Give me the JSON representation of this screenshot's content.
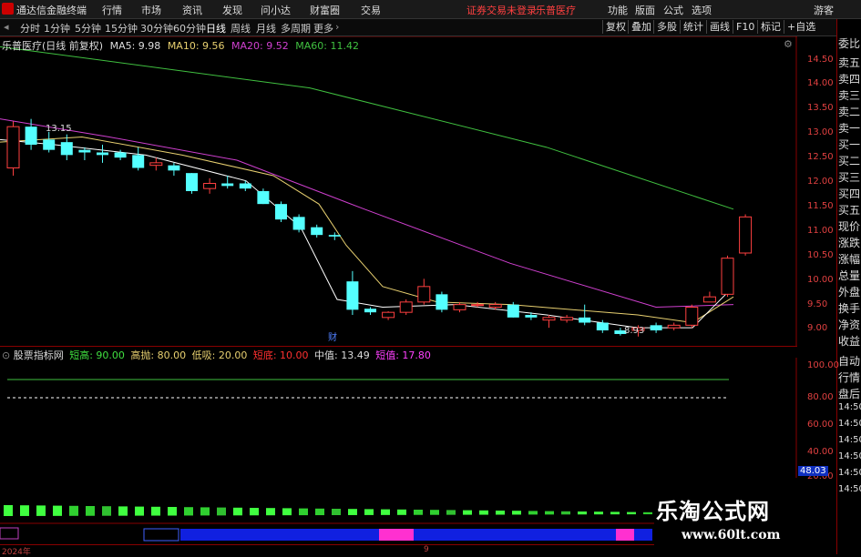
{
  "menubar": {
    "app_title": "通达信金融终端",
    "items": [
      "行情",
      "市场",
      "资讯",
      "发现",
      "问小达",
      "财富圈",
      "交易"
    ],
    "warning": "证券交易未登录",
    "stock_name": "乐普医疗",
    "right_items": [
      "功能",
      "版面",
      "公式",
      "选项"
    ],
    "guest": "游客"
  },
  "periodbar": {
    "periods": [
      "分时",
      "1分钟",
      "5分钟",
      "15分钟",
      "30分钟",
      "60分钟",
      "日线",
      "周线",
      "月线",
      "多周期",
      "更多"
    ],
    "selected": "日线",
    "tools": [
      "复权",
      "叠加",
      "多股",
      "统计",
      "画线",
      "F10",
      "标记",
      "+自选"
    ]
  },
  "chart": {
    "title": "乐普医疗(日线 前复权)",
    "ma": [
      {
        "label": "MA5: 9.98",
        "color": "#ffffff"
      },
      {
        "label": "MA10: 9.56",
        "color": "#e8d070"
      },
      {
        "label": "MA20: 9.52",
        "color": "#d040d0"
      },
      {
        "label": "MA60: 11.42",
        "color": "#40c040"
      }
    ],
    "high_label": "13.15",
    "low_label": "8.93",
    "annotation": "财",
    "axis": [
      "14.50",
      "14.00",
      "13.50",
      "13.00",
      "12.50",
      "12.00",
      "11.50",
      "11.00",
      "10.50",
      "10.00",
      "9.50",
      "9.00"
    ],
    "colors": {
      "up": "#ff4040",
      "down": "#54ffff",
      "ma60": "#40c040",
      "ma20": "#d040d0",
      "ma10": "#e8d070",
      "ma5": "#ffffff"
    }
  },
  "chart_data": {
    "type": "candlestick",
    "ylim": [
      8.75,
      14.75
    ],
    "candles": [
      {
        "o": 12.2,
        "c": 13.0,
        "h": 13.1,
        "l": 12.05
      },
      {
        "o": 13.0,
        "c": 12.65,
        "h": 13.15,
        "l": 12.55
      },
      {
        "o": 12.75,
        "c": 12.55,
        "h": 12.9,
        "l": 12.5
      },
      {
        "o": 12.7,
        "c": 12.45,
        "h": 12.85,
        "l": 12.35
      },
      {
        "o": 12.55,
        "c": 12.5,
        "h": 12.6,
        "l": 12.35
      },
      {
        "o": 12.5,
        "c": 12.45,
        "h": 12.65,
        "l": 12.3
      },
      {
        "o": 12.5,
        "c": 12.4,
        "h": 12.55,
        "l": 12.35
      },
      {
        "o": 12.45,
        "c": 12.2,
        "h": 12.6,
        "l": 12.15
      },
      {
        "o": 12.25,
        "c": 12.3,
        "h": 12.4,
        "l": 12.15
      },
      {
        "o": 12.25,
        "c": 12.15,
        "h": 12.3,
        "l": 12.05
      },
      {
        "o": 12.1,
        "c": 11.75,
        "h": 12.1,
        "l": 11.7
      },
      {
        "o": 11.8,
        "c": 11.9,
        "h": 12.0,
        "l": 11.7
      },
      {
        "o": 11.9,
        "c": 11.85,
        "h": 12.05,
        "l": 11.8
      },
      {
        "o": 11.9,
        "c": 11.8,
        "h": 11.95,
        "l": 11.75
      },
      {
        "o": 11.75,
        "c": 11.5,
        "h": 11.8,
        "l": 11.5
      },
      {
        "o": 11.5,
        "c": 11.2,
        "h": 11.55,
        "l": 11.15
      },
      {
        "o": 11.25,
        "c": 11.0,
        "h": 11.3,
        "l": 10.95
      },
      {
        "o": 11.05,
        "c": 10.9,
        "h": 11.1,
        "l": 10.85
      },
      {
        "o": 10.9,
        "c": 10.87,
        "h": 10.95,
        "l": 10.8
      },
      {
        "o": 10.0,
        "c": 9.45,
        "h": 10.2,
        "l": 9.35
      },
      {
        "o": 9.47,
        "c": 9.4,
        "h": 9.5,
        "l": 9.35
      },
      {
        "o": 9.3,
        "c": 9.4,
        "h": 9.42,
        "l": 9.25
      },
      {
        "o": 9.4,
        "c": 9.6,
        "h": 9.65,
        "l": 9.35
      },
      {
        "o": 9.6,
        "c": 9.9,
        "h": 10.05,
        "l": 9.55
      },
      {
        "o": 9.75,
        "c": 9.45,
        "h": 9.8,
        "l": 9.4
      },
      {
        "o": 9.45,
        "c": 9.55,
        "h": 9.6,
        "l": 9.4
      },
      {
        "o": 9.55,
        "c": 9.55,
        "h": 9.6,
        "l": 9.5
      },
      {
        "o": 9.5,
        "c": 9.55,
        "h": 9.6,
        "l": 9.45
      },
      {
        "o": 9.55,
        "c": 9.3,
        "h": 9.6,
        "l": 9.3
      },
      {
        "o": 9.35,
        "c": 9.3,
        "h": 9.4,
        "l": 9.25
      },
      {
        "o": 9.25,
        "c": 9.3,
        "h": 9.35,
        "l": 9.1
      },
      {
        "o": 9.25,
        "c": 9.3,
        "h": 9.35,
        "l": 9.2
      },
      {
        "o": 9.3,
        "c": 9.2,
        "h": 9.55,
        "l": 9.15
      },
      {
        "o": 9.2,
        "c": 9.05,
        "h": 9.25,
        "l": 9.0
      },
      {
        "o": 9.05,
        "c": 8.98,
        "h": 9.1,
        "l": 8.95
      },
      {
        "o": 9.05,
        "c": 9.1,
        "h": 9.15,
        "l": 8.93
      },
      {
        "o": 9.15,
        "c": 9.05,
        "h": 9.2,
        "l": 9.0
      },
      {
        "o": 9.1,
        "c": 9.15,
        "h": 9.2,
        "l": 9.05
      },
      {
        "o": 9.15,
        "c": 9.5,
        "h": 9.55,
        "l": 9.1
      },
      {
        "o": 9.6,
        "c": 9.7,
        "h": 9.8,
        "l": 9.6
      },
      {
        "o": 9.75,
        "c": 10.45,
        "h": 10.5,
        "l": 9.7
      },
      {
        "o": 10.55,
        "c": 11.25,
        "h": 11.3,
        "l": 10.5
      }
    ],
    "ma60": [
      [
        0,
        14.55
      ],
      [
        340,
        13.75
      ],
      [
        600,
        12.6
      ],
      [
        805,
        11.4
      ]
    ],
    "ma20": [
      [
        0,
        13.15
      ],
      [
        120,
        12.8
      ],
      [
        260,
        12.35
      ],
      [
        400,
        11.4
      ],
      [
        560,
        10.35
      ],
      [
        720,
        9.5
      ],
      [
        805,
        9.55
      ]
    ],
    "ma10": [
      [
        0,
        12.7
      ],
      [
        90,
        12.8
      ],
      [
        200,
        12.45
      ],
      [
        300,
        12.05
      ],
      [
        350,
        11.5
      ],
      [
        380,
        10.7
      ],
      [
        420,
        9.9
      ],
      [
        480,
        9.6
      ],
      [
        560,
        9.55
      ],
      [
        700,
        9.35
      ],
      [
        760,
        9.2
      ],
      [
        805,
        9.7
      ]
    ],
    "ma5": [
      [
        0,
        12.75
      ],
      [
        60,
        12.65
      ],
      [
        160,
        12.45
      ],
      [
        270,
        11.95
      ],
      [
        330,
        11.05
      ],
      [
        370,
        9.65
      ],
      [
        420,
        9.5
      ],
      [
        500,
        9.55
      ],
      [
        600,
        9.35
      ],
      [
        700,
        9.1
      ],
      [
        760,
        9.1
      ],
      [
        805,
        9.9
      ]
    ]
  },
  "indicator": {
    "name": "股票指标网",
    "items": [
      {
        "label": "短高: 90.00",
        "color": "#40e040"
      },
      {
        "label": "高抛: 80.00",
        "color": "#e8d070"
      },
      {
        "label": "低吸: 20.00",
        "color": "#e8d070"
      },
      {
        "label": "短底: 10.00",
        "color": "#ff3030"
      },
      {
        "label": "中值: 13.49",
        "color": "#dddddd"
      },
      {
        "label": "短值: 17.80",
        "color": "#ff40ff"
      }
    ],
    "axis": [
      "100.00",
      "80.00",
      "60.00",
      "40.00",
      "20.00"
    ],
    "current": "48.03"
  },
  "datebar": {
    "year": "2024年",
    "month": "9"
  },
  "orderbook": [
    "委比",
    "卖五",
    "卖四",
    "卖三",
    "卖二",
    "卖一",
    "买一",
    "买二",
    "买三",
    "买四",
    "买五",
    "现价",
    "涨跌",
    "涨幅",
    "总量",
    "外盘",
    "换手",
    "净资",
    "收益",
    "自动",
    "行情",
    "盘后",
    "14:50",
    "14:50",
    "14:50",
    "14:50",
    "14:50",
    "14:50"
  ],
  "watermark": {
    "title": "乐淘公式网",
    "url": "www.60lt.com"
  }
}
